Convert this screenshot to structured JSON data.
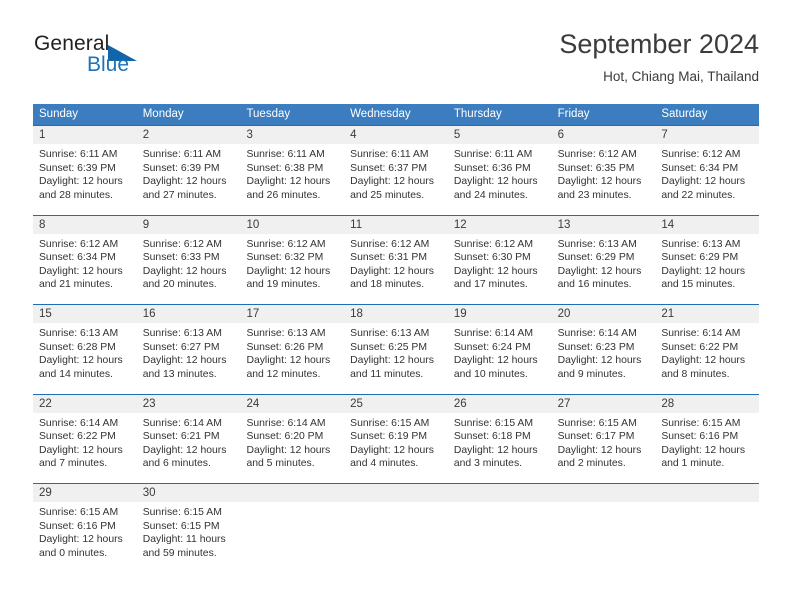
{
  "brand": {
    "name_top": "General",
    "name_bottom": "Blue",
    "triangle_color": "#1166ab",
    "blue_color": "#1f72b8"
  },
  "header": {
    "title": "September 2024",
    "subtitle": "Hot, Chiang Mai, Thailand"
  },
  "calendar": {
    "header_bg": "#3b7dbf",
    "row_divider": "#1f6db5",
    "daynum_bg": "#f0f0f0",
    "weekdays": [
      "Sunday",
      "Monday",
      "Tuesday",
      "Wednesday",
      "Thursday",
      "Friday",
      "Saturday"
    ],
    "weeks": [
      [
        {
          "day": "1",
          "sunrise": "Sunrise: 6:11 AM",
          "sunset": "Sunset: 6:39 PM",
          "daylight1": "Daylight: 12 hours",
          "daylight2": "and 28 minutes."
        },
        {
          "day": "2",
          "sunrise": "Sunrise: 6:11 AM",
          "sunset": "Sunset: 6:39 PM",
          "daylight1": "Daylight: 12 hours",
          "daylight2": "and 27 minutes."
        },
        {
          "day": "3",
          "sunrise": "Sunrise: 6:11 AM",
          "sunset": "Sunset: 6:38 PM",
          "daylight1": "Daylight: 12 hours",
          "daylight2": "and 26 minutes."
        },
        {
          "day": "4",
          "sunrise": "Sunrise: 6:11 AM",
          "sunset": "Sunset: 6:37 PM",
          "daylight1": "Daylight: 12 hours",
          "daylight2": "and 25 minutes."
        },
        {
          "day": "5",
          "sunrise": "Sunrise: 6:11 AM",
          "sunset": "Sunset: 6:36 PM",
          "daylight1": "Daylight: 12 hours",
          "daylight2": "and 24 minutes."
        },
        {
          "day": "6",
          "sunrise": "Sunrise: 6:12 AM",
          "sunset": "Sunset: 6:35 PM",
          "daylight1": "Daylight: 12 hours",
          "daylight2": "and 23 minutes."
        },
        {
          "day": "7",
          "sunrise": "Sunrise: 6:12 AM",
          "sunset": "Sunset: 6:34 PM",
          "daylight1": "Daylight: 12 hours",
          "daylight2": "and 22 minutes."
        }
      ],
      [
        {
          "day": "8",
          "sunrise": "Sunrise: 6:12 AM",
          "sunset": "Sunset: 6:34 PM",
          "daylight1": "Daylight: 12 hours",
          "daylight2": "and 21 minutes."
        },
        {
          "day": "9",
          "sunrise": "Sunrise: 6:12 AM",
          "sunset": "Sunset: 6:33 PM",
          "daylight1": "Daylight: 12 hours",
          "daylight2": "and 20 minutes."
        },
        {
          "day": "10",
          "sunrise": "Sunrise: 6:12 AM",
          "sunset": "Sunset: 6:32 PM",
          "daylight1": "Daylight: 12 hours",
          "daylight2": "and 19 minutes."
        },
        {
          "day": "11",
          "sunrise": "Sunrise: 6:12 AM",
          "sunset": "Sunset: 6:31 PM",
          "daylight1": "Daylight: 12 hours",
          "daylight2": "and 18 minutes."
        },
        {
          "day": "12",
          "sunrise": "Sunrise: 6:12 AM",
          "sunset": "Sunset: 6:30 PM",
          "daylight1": "Daylight: 12 hours",
          "daylight2": "and 17 minutes."
        },
        {
          "day": "13",
          "sunrise": "Sunrise: 6:13 AM",
          "sunset": "Sunset: 6:29 PM",
          "daylight1": "Daylight: 12 hours",
          "daylight2": "and 16 minutes."
        },
        {
          "day": "14",
          "sunrise": "Sunrise: 6:13 AM",
          "sunset": "Sunset: 6:29 PM",
          "daylight1": "Daylight: 12 hours",
          "daylight2": "and 15 minutes."
        }
      ],
      [
        {
          "day": "15",
          "sunrise": "Sunrise: 6:13 AM",
          "sunset": "Sunset: 6:28 PM",
          "daylight1": "Daylight: 12 hours",
          "daylight2": "and 14 minutes."
        },
        {
          "day": "16",
          "sunrise": "Sunrise: 6:13 AM",
          "sunset": "Sunset: 6:27 PM",
          "daylight1": "Daylight: 12 hours",
          "daylight2": "and 13 minutes."
        },
        {
          "day": "17",
          "sunrise": "Sunrise: 6:13 AM",
          "sunset": "Sunset: 6:26 PM",
          "daylight1": "Daylight: 12 hours",
          "daylight2": "and 12 minutes."
        },
        {
          "day": "18",
          "sunrise": "Sunrise: 6:13 AM",
          "sunset": "Sunset: 6:25 PM",
          "daylight1": "Daylight: 12 hours",
          "daylight2": "and 11 minutes."
        },
        {
          "day": "19",
          "sunrise": "Sunrise: 6:14 AM",
          "sunset": "Sunset: 6:24 PM",
          "daylight1": "Daylight: 12 hours",
          "daylight2": "and 10 minutes."
        },
        {
          "day": "20",
          "sunrise": "Sunrise: 6:14 AM",
          "sunset": "Sunset: 6:23 PM",
          "daylight1": "Daylight: 12 hours",
          "daylight2": "and 9 minutes."
        },
        {
          "day": "21",
          "sunrise": "Sunrise: 6:14 AM",
          "sunset": "Sunset: 6:22 PM",
          "daylight1": "Daylight: 12 hours",
          "daylight2": "and 8 minutes."
        }
      ],
      [
        {
          "day": "22",
          "sunrise": "Sunrise: 6:14 AM",
          "sunset": "Sunset: 6:22 PM",
          "daylight1": "Daylight: 12 hours",
          "daylight2": "and 7 minutes."
        },
        {
          "day": "23",
          "sunrise": "Sunrise: 6:14 AM",
          "sunset": "Sunset: 6:21 PM",
          "daylight1": "Daylight: 12 hours",
          "daylight2": "and 6 minutes."
        },
        {
          "day": "24",
          "sunrise": "Sunrise: 6:14 AM",
          "sunset": "Sunset: 6:20 PM",
          "daylight1": "Daylight: 12 hours",
          "daylight2": "and 5 minutes."
        },
        {
          "day": "25",
          "sunrise": "Sunrise: 6:15 AM",
          "sunset": "Sunset: 6:19 PM",
          "daylight1": "Daylight: 12 hours",
          "daylight2": "and 4 minutes."
        },
        {
          "day": "26",
          "sunrise": "Sunrise: 6:15 AM",
          "sunset": "Sunset: 6:18 PM",
          "daylight1": "Daylight: 12 hours",
          "daylight2": "and 3 minutes."
        },
        {
          "day": "27",
          "sunrise": "Sunrise: 6:15 AM",
          "sunset": "Sunset: 6:17 PM",
          "daylight1": "Daylight: 12 hours",
          "daylight2": "and 2 minutes."
        },
        {
          "day": "28",
          "sunrise": "Sunrise: 6:15 AM",
          "sunset": "Sunset: 6:16 PM",
          "daylight1": "Daylight: 12 hours",
          "daylight2": "and 1 minute."
        }
      ],
      [
        {
          "day": "29",
          "sunrise": "Sunrise: 6:15 AM",
          "sunset": "Sunset: 6:16 PM",
          "daylight1": "Daylight: 12 hours",
          "daylight2": "and 0 minutes."
        },
        {
          "day": "30",
          "sunrise": "Sunrise: 6:15 AM",
          "sunset": "Sunset: 6:15 PM",
          "daylight1": "Daylight: 11 hours",
          "daylight2": "and 59 minutes."
        },
        {
          "day": "",
          "sunrise": "",
          "sunset": "",
          "daylight1": "",
          "daylight2": ""
        },
        {
          "day": "",
          "sunrise": "",
          "sunset": "",
          "daylight1": "",
          "daylight2": ""
        },
        {
          "day": "",
          "sunrise": "",
          "sunset": "",
          "daylight1": "",
          "daylight2": ""
        },
        {
          "day": "",
          "sunrise": "",
          "sunset": "",
          "daylight1": "",
          "daylight2": ""
        },
        {
          "day": "",
          "sunrise": "",
          "sunset": "",
          "daylight1": "",
          "daylight2": ""
        }
      ]
    ]
  }
}
